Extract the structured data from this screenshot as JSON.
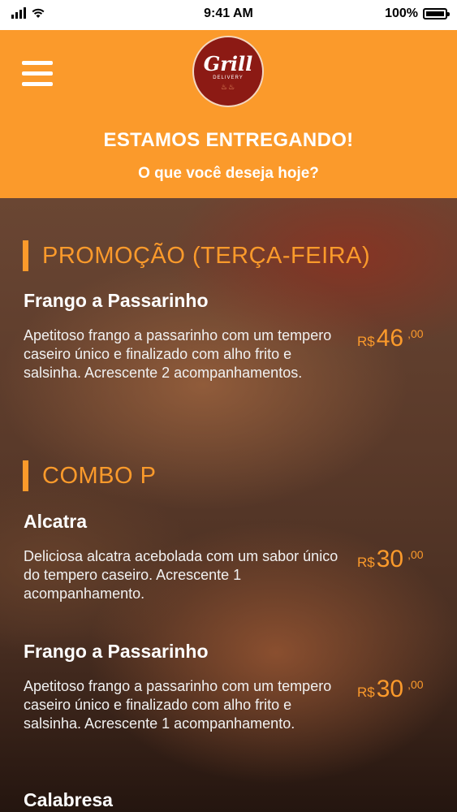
{
  "status_bar": {
    "time": "9:41 AM",
    "battery": "100%"
  },
  "header": {
    "logo_text": "Grill",
    "logo_subtext": "DELIVERY",
    "title": "ESTAMOS ENTREGANDO!",
    "subtitle": "O que você deseja hoje?"
  },
  "sections": [
    {
      "title": "PROMOÇÃO (TERÇA-FEIRA)",
      "items": [
        {
          "name": "Frango a Passarinho",
          "description": "Apetitoso frango a passarinho com um tempero caseiro único e finalizado com alho frito e salsinha. Acrescente 2 acompanhamentos.",
          "currency": "R$",
          "price": "46",
          "cents": ",00"
        }
      ]
    },
    {
      "title": "COMBO P",
      "items": [
        {
          "name": "Alcatra",
          "description": "Deliciosa alcatra acebolada com um sabor único do tempero caseiro. Acrescente 1 acompanhamento.",
          "currency": "R$",
          "price": "30",
          "cents": ",00"
        },
        {
          "name": "Frango a Passarinho",
          "description": "Apetitoso frango a passarinho com um tempero caseiro único e finalizado com alho frito e salsinha. Acrescente 1 acompanhamento.",
          "currency": "R$",
          "price": "30",
          "cents": ",00"
        },
        {
          "name": "Calabresa"
        }
      ]
    }
  ]
}
